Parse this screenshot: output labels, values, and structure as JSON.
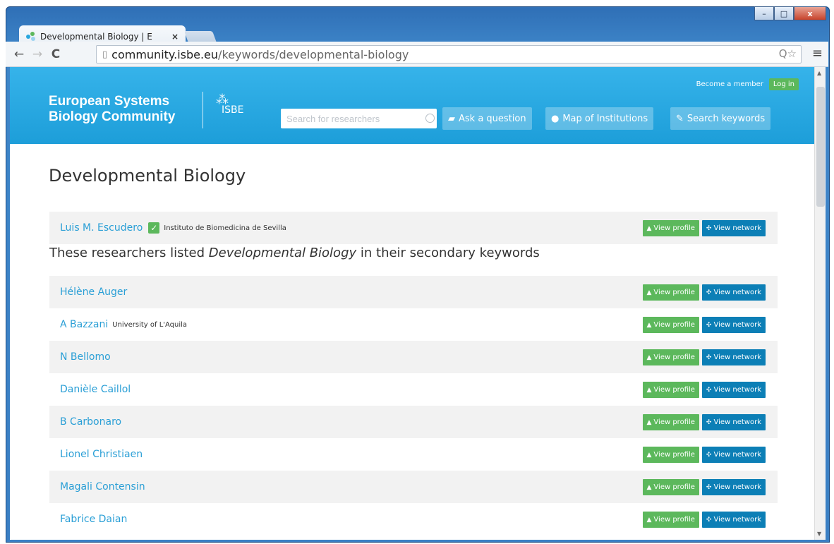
{
  "browser": {
    "tab_title": "Developmental Biology | E",
    "tab_close": "×",
    "url_host": "community.isbe.eu",
    "url_path": "/keywords/developmental-biology",
    "omnibox_icons": "Q☆",
    "menu_icon": "≡",
    "window_buttons": {
      "minimize": "–",
      "maximize": "□",
      "close": "x"
    }
  },
  "header": {
    "brand_line1": "European Systems",
    "brand_line2": "Biology Community",
    "isbe_label": "ISBE",
    "become_member": "Become a member",
    "login": "Log in",
    "search_placeholder": "Search for researchers",
    "ask_question": "Ask a question",
    "map_institutions": "Map of Institutions",
    "search_keywords": "Search keywords"
  },
  "page": {
    "title": "Developmental Biology",
    "secondary_prefix": "These researchers listed ",
    "secondary_keyword": "Developmental Biology",
    "secondary_suffix": " in their secondary keywords",
    "view_profile": "View profile",
    "view_network": "View network",
    "primary": {
      "name": "Luis M. Escudero",
      "verified": "✓",
      "institution": "Instituto de Biomedicina de Sevilla"
    },
    "researchers": [
      {
        "name": "Hélène Auger",
        "institution": ""
      },
      {
        "name": "A Bazzani",
        "institution": "University of L'Aquila"
      },
      {
        "name": "N Bellomo",
        "institution": ""
      },
      {
        "name": "Danièle Caillol",
        "institution": ""
      },
      {
        "name": "B Carbonaro",
        "institution": ""
      },
      {
        "name": "Lionel Christiaen",
        "institution": ""
      },
      {
        "name": "Magali Contensin",
        "institution": ""
      },
      {
        "name": "Fabrice Daian",
        "institution": ""
      }
    ]
  },
  "colors": {
    "header": "#1d9ed9",
    "green": "#5cb85c",
    "blue": "#0c7fb6",
    "link": "#2a9fd6"
  }
}
